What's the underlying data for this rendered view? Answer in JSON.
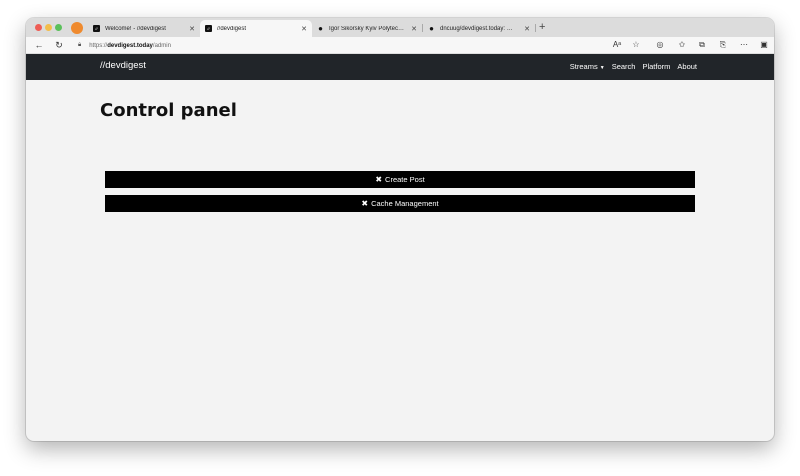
{
  "browser": {
    "tabs": [
      {
        "title": "Welcome! - //devdigest",
        "favicon": "devdigest-icon",
        "active": false
      },
      {
        "title": "//devdigest",
        "favicon": "devdigest-icon",
        "active": true
      },
      {
        "title": "Igor Sikorsky Kyiv Polytechnic I",
        "favicon": "github-icon",
        "active": false
      },
      {
        "title": "dncuug/devdigest.today: 🇺🇦 Hi",
        "favicon": "github-icon",
        "active": false
      }
    ],
    "url_prefix": "https://",
    "url_domain": "devdigest.today",
    "url_path": "/admin"
  },
  "site": {
    "brand": "//devdigest",
    "nav": {
      "streams": "Streams",
      "search": "Search",
      "platform": "Platform",
      "about": "About"
    }
  },
  "main": {
    "title": "Control panel",
    "actions": [
      {
        "label": "Create Post",
        "icon": "tools-icon"
      },
      {
        "label": "Cache Management",
        "icon": "tools-icon"
      }
    ]
  },
  "colors": {
    "navbar": "#212529",
    "button": "#000000",
    "page_bg": "#f3f3f3"
  }
}
